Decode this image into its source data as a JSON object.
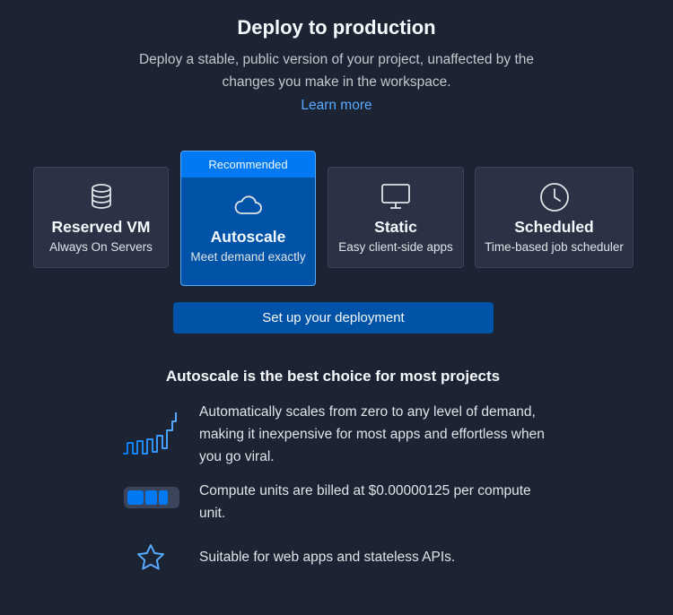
{
  "header": {
    "title": "Deploy to production",
    "subtitle": "Deploy a stable, public version of your project, unaffected by the changes you make in the workspace.",
    "learn_more": "Learn more"
  },
  "deployment_types": [
    {
      "name": "Reserved VM",
      "description": "Always On Servers",
      "icon": "database-icon"
    },
    {
      "name": "Autoscale",
      "description": "Meet demand exactly",
      "icon": "cloud-icon",
      "badge": "Recommended",
      "selected": true
    },
    {
      "name": "Static",
      "description": "Easy client-side apps",
      "icon": "monitor-icon"
    },
    {
      "name": "Scheduled",
      "description": "Time-based job scheduler",
      "icon": "clock-icon"
    }
  ],
  "cta": {
    "label": "Set up your deployment"
  },
  "details": {
    "title": "Autoscale is the best choice for most projects",
    "features": [
      {
        "icon": "demand-graph-icon",
        "text": "Automatically scales from zero to any level of demand, making it inexpensive for most apps and effortless when you go viral."
      },
      {
        "icon": "compute-units-icon",
        "text": "Compute units are billed at $0.00000125 per compute unit."
      },
      {
        "icon": "star-icon",
        "text": "Suitable for web apps and stateless APIs."
      }
    ]
  },
  "colors": {
    "background": "#1c2333",
    "card": "#2b3245",
    "selected_card": "#0053a6",
    "badge": "#0079f2",
    "accent": "#57abff"
  }
}
